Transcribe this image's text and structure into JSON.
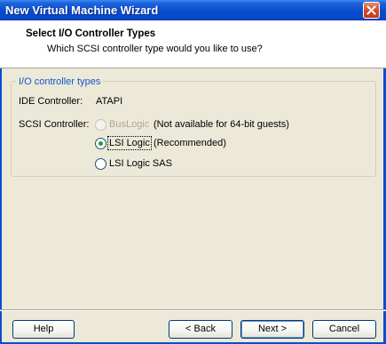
{
  "window": {
    "title": "New Virtual Machine Wizard"
  },
  "header": {
    "title": "Select I/O Controller Types",
    "subtitle": "Which SCSI controller type would you like to use?"
  },
  "group": {
    "legend": "I/O controller types",
    "ide": {
      "label": "IDE Controller:",
      "value": "ATAPI"
    },
    "scsi": {
      "label": "SCSI Controller:",
      "options": [
        {
          "label": "BusLogic",
          "note": "(Not available for 64-bit guests)",
          "selected": false,
          "enabled": false
        },
        {
          "label": "LSI Logic",
          "note": "(Recommended)",
          "selected": true,
          "enabled": true
        },
        {
          "label": "LSI Logic SAS",
          "note": "",
          "selected": false,
          "enabled": true
        }
      ]
    }
  },
  "buttons": {
    "help": "Help",
    "back": "< Back",
    "next": "Next >",
    "cancel": "Cancel"
  },
  "colors": {
    "titlebar": "#0a4dd0",
    "legend": "#1155cc",
    "radio_selected": "#21a121"
  },
  "icons": {
    "close": "close-icon"
  }
}
